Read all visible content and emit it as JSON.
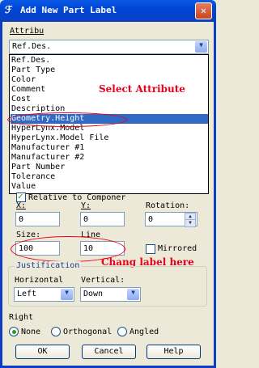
{
  "window": {
    "title": "Add New Part Label",
    "close_glyph": "✕",
    "icon": "pcb-label-icon"
  },
  "attribute": {
    "label": "Attribu",
    "selected": "Ref.Des.",
    "options": [
      "Ref.Des.",
      "Part Type",
      "Color",
      "Comment",
      "Cost",
      "Description",
      "Geometry.Height",
      "HyperLynx.Model",
      "HyperLynx.Model File",
      "Manufacturer #1",
      "Manufacturer #2",
      "Part Number",
      "Tolerance",
      "Value"
    ],
    "highlighted_index": 6
  },
  "relative_checkbox": {
    "label": "Relative to Componer",
    "checked": true
  },
  "fields": {
    "x": {
      "label": "X:",
      "value": "0"
    },
    "y": {
      "label": "Y:",
      "value": "0"
    },
    "rotation": {
      "label": "Rotation:",
      "value": "0"
    },
    "size": {
      "label": "Size:",
      "value": "100"
    },
    "line": {
      "label": "Line",
      "value": "10"
    }
  },
  "mirrored": {
    "label": "Mirrored",
    "checked": false
  },
  "justification": {
    "group_label": "Justification",
    "horizontal": {
      "label": "Horizontal",
      "value": "Left"
    },
    "vertical": {
      "label": "Vertical:",
      "value": "Down"
    }
  },
  "right": {
    "label": "Right",
    "options": [
      {
        "label": "None",
        "checked": true
      },
      {
        "label": "Orthogonal",
        "checked": false
      },
      {
        "label": "Angled",
        "checked": false
      }
    ]
  },
  "buttons": {
    "ok": "OK",
    "cancel": "Cancel",
    "help": "Help"
  },
  "annotations": {
    "select_attribute": "Select Attribute",
    "change_label": "Chang label here"
  },
  "colors": {
    "annotation": "#e8001c",
    "selection": "#316ac5",
    "title_bar": "#0046d5"
  }
}
